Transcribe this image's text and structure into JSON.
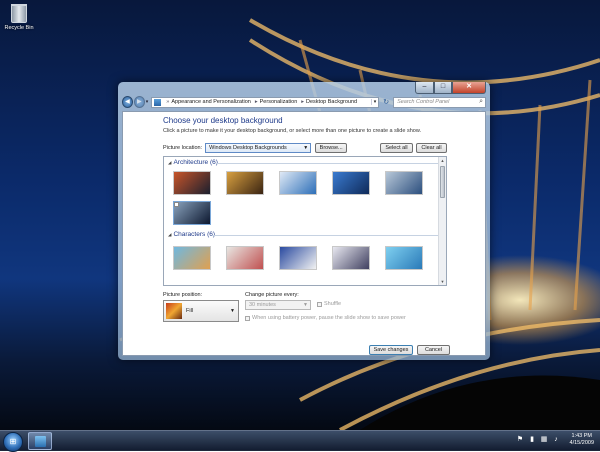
{
  "desktop": {
    "recycle_bin_label": "Recycle Bin"
  },
  "window": {
    "address": {
      "crumbs": [
        "Appearance and Personalization",
        "Personalization",
        "Desktop Background"
      ],
      "search_placeholder": "Search Control Panel"
    },
    "title": "Choose your desktop background",
    "subtitle": "Click a picture to make it your desktop background, or select more than one picture to create a slide show.",
    "picture_location_label": "Picture location:",
    "picture_location_value": "Windows Desktop Backgrounds",
    "browse_label": "Browse...",
    "select_all_label": "Select all",
    "clear_all_label": "Clear all",
    "groups": [
      {
        "header": "Architecture (6)",
        "thumbs": [
          {
            "c1": "#c8552a",
            "c2": "#1b1f2e"
          },
          {
            "c1": "#d8a040",
            "c2": "#3a2412"
          },
          {
            "c1": "#dfe9f5",
            "c2": "#2d6fb8"
          },
          {
            "c1": "#3a7bd0",
            "c2": "#0f2a5a"
          },
          {
            "c1": "#b8c8d8",
            "c2": "#2c4f7e"
          },
          {
            "c1": "#8aa2bc",
            "c2": "#0c1830"
          }
        ]
      },
      {
        "header": "Characters (6)",
        "thumbs": [
          {
            "c1": "#6fb8e0",
            "c2": "#e0a050"
          },
          {
            "c1": "#e8e6e2",
            "c2": "#c05050"
          },
          {
            "c1": "#2a4aa0",
            "c2": "#f2f2f2"
          },
          {
            "c1": "#e8e8f0",
            "c2": "#404060"
          },
          {
            "c1": "#7fd0f0",
            "c2": "#2a7ab8"
          }
        ]
      }
    ],
    "picture_position_label": "Picture position:",
    "picture_position_value": "Fill",
    "change_every_label": "Change picture every:",
    "change_every_value": "30 minutes",
    "shuffle_label": "Shuffle",
    "battery_label": "When using battery power, pause the slide show to save power",
    "save_label": "Save changes",
    "cancel_label": "Cancel"
  },
  "taskbar": {
    "time": "1:43 PM",
    "date": "4/15/2009"
  }
}
